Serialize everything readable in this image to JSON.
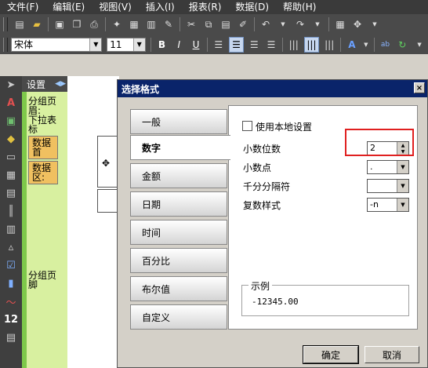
{
  "menubar": {
    "items": [
      "文件(F)",
      "编辑(E)",
      "视图(V)",
      "插入(I)",
      "报表(R)",
      "数据(D)",
      "帮助(H)"
    ]
  },
  "toolbar2": {
    "font_name": "宋体",
    "font_size": "11",
    "bold_label": "B",
    "italic_label": "I",
    "underline_label": "U"
  },
  "design_panel": {
    "header": "设置",
    "bands": [
      "分组页眉:",
      "下拉表标",
      "数据首",
      "数据区:",
      "分组页脚"
    ]
  },
  "dialog": {
    "title": "选择格式",
    "close_label": "×",
    "tabs": [
      "一般",
      "数字",
      "金额",
      "日期",
      "时间",
      "百分比",
      "布尔值",
      "自定义"
    ],
    "active_tab": "数字",
    "use_local_settings": "使用本地设置",
    "decimal_places_label": "小数位数",
    "decimal_places_value": "2",
    "decimal_point_label": "小数点",
    "decimal_point_value": ".",
    "thousands_sep_label": "千分分隔符",
    "thousands_sep_value": "",
    "negative_style_label": "复数样式",
    "negative_style_value": "-n",
    "example_label": "示例",
    "example_value": "-12345.00",
    "ok_label": "确定",
    "cancel_label": "取消"
  },
  "colors": {
    "title_bar": "#0a246a",
    "highlight": "#e02020",
    "band_green": "#d8f0a0"
  }
}
